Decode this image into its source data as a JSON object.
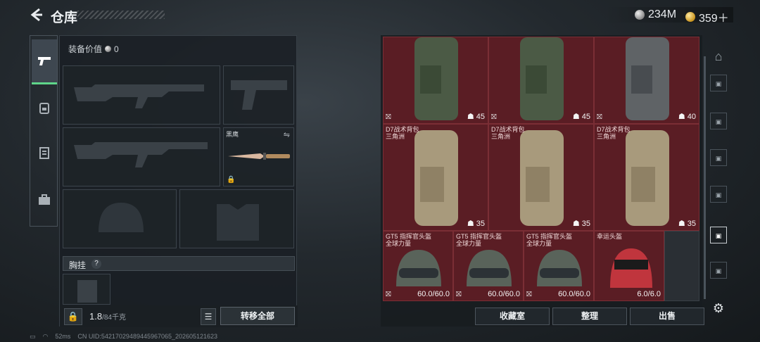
{
  "header": {
    "title": "仓库",
    "currency_silver": "234M",
    "currency_gold": "359＋"
  },
  "left_rail": {
    "items": [
      "pistol-icon",
      "bag-icon",
      "clipboard-icon",
      "briefcase-icon"
    ]
  },
  "equip": {
    "value_label": "装备价值",
    "value": "0",
    "knife_label": "黑鹰",
    "chest_label": "胸挂",
    "chest_help": "?"
  },
  "bottom": {
    "weight_current": "1.8",
    "weight_max": "/84千克",
    "transfer_label": "转移全部"
  },
  "grid": {
    "backpack_counts": [
      "45",
      "45",
      "40"
    ],
    "d7_name": "D7战术背包",
    "d7_sub": "三角洲",
    "d7_counts": [
      "35",
      "35",
      "35"
    ],
    "helmets": [
      {
        "name": "GT5 指挥官头盔",
        "sub": "全球力量",
        "dur": "60.0/60.0"
      },
      {
        "name": "GT5 指挥官头盔",
        "sub": "全球力量",
        "dur": "60.0/60.0"
      },
      {
        "name": "GT5 指挥官头盔",
        "sub": "全球力量",
        "dur": "60.0/60.0"
      },
      {
        "name": "幸运头盔",
        "sub": "",
        "dur": "6.0/6.0"
      }
    ]
  },
  "actions": {
    "collection": "收藏室",
    "organize": "整理",
    "sell": "出售"
  },
  "status": {
    "ping": "52ms",
    "uid": "CN UID:54217029489445967065_202605121623"
  },
  "colors": {
    "accent": "#5fd58a",
    "cell_bg": "#5a1d24"
  }
}
